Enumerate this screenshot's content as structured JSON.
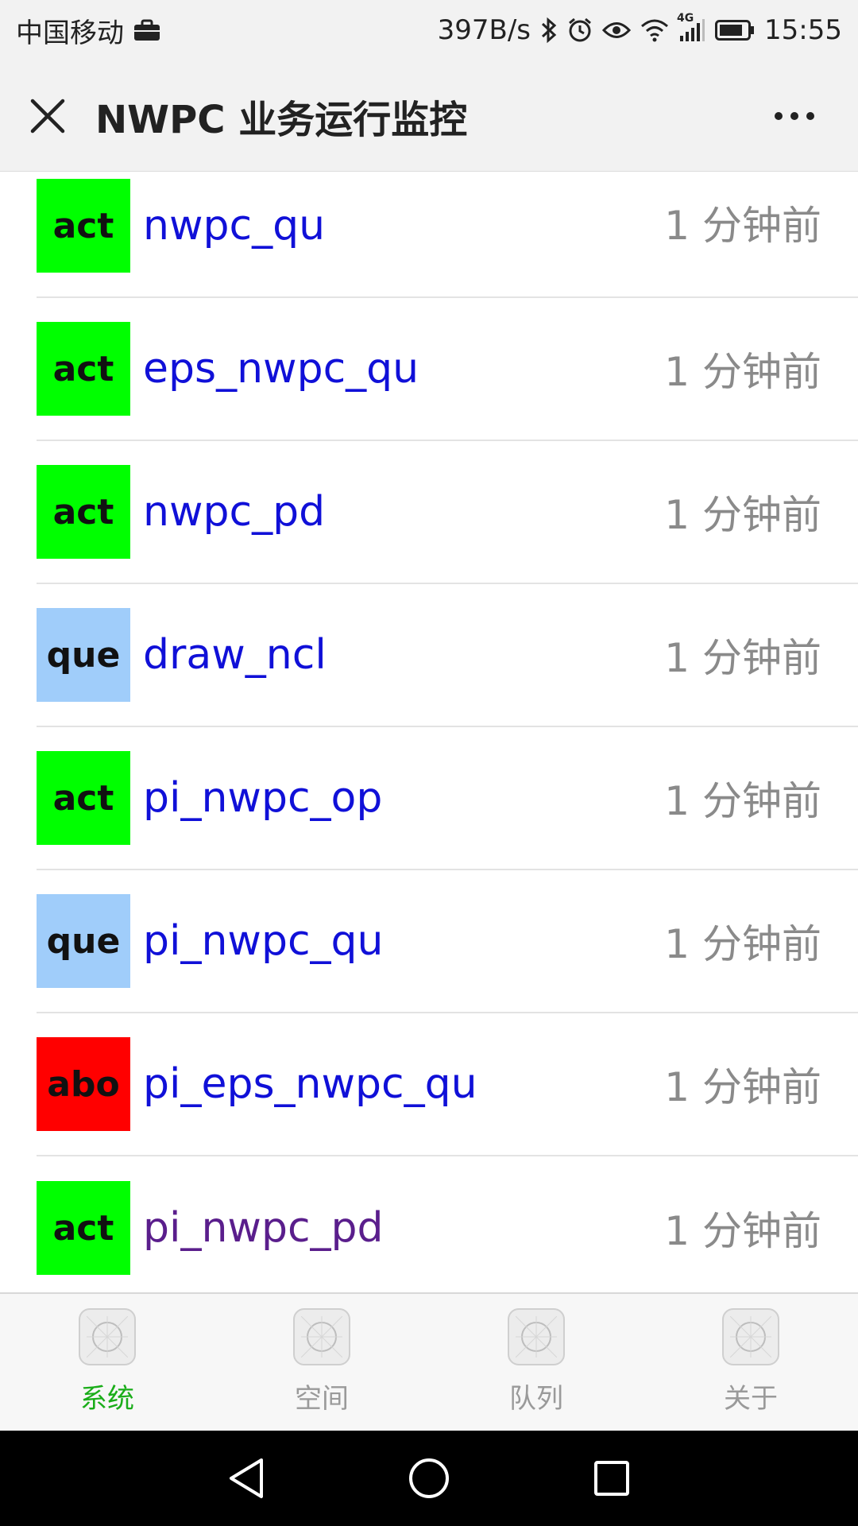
{
  "status_bar": {
    "carrier": "中国移动",
    "net_speed": "397B/s",
    "network": "4G",
    "time": "15:55"
  },
  "header": {
    "title": "NWPC 业务运行监控"
  },
  "list": {
    "items": [
      {
        "status": "act",
        "status_color": "#00ff00",
        "name": "nwpc_qu",
        "name_color": "#1010d8",
        "time": "1 分钟前"
      },
      {
        "status": "act",
        "status_color": "#00ff00",
        "name": "eps_nwpc_qu",
        "name_color": "#1010d8",
        "time": "1 分钟前"
      },
      {
        "status": "act",
        "status_color": "#00ff00",
        "name": "nwpc_pd",
        "name_color": "#1010d8",
        "time": "1 分钟前"
      },
      {
        "status": "que",
        "status_color": "#a0cdfa",
        "name": "draw_ncl",
        "name_color": "#1010d8",
        "time": "1 分钟前"
      },
      {
        "status": "act",
        "status_color": "#00ff00",
        "name": "pi_nwpc_op",
        "name_color": "#1010d8",
        "time": "1 分钟前"
      },
      {
        "status": "que",
        "status_color": "#a0cdfa",
        "name": "pi_nwpc_qu",
        "name_color": "#1010d8",
        "time": "1 分钟前"
      },
      {
        "status": "abo",
        "status_color": "#ff0000",
        "name": "pi_eps_nwpc_qu",
        "name_color": "#1010d8",
        "time": "1 分钟前"
      },
      {
        "status": "act",
        "status_color": "#00ff00",
        "name": "pi_nwpc_pd",
        "name_color": "#5a1e8c",
        "time": "1 分钟前"
      }
    ]
  },
  "tabbar": {
    "tabs": [
      {
        "label": "系统",
        "active": true
      },
      {
        "label": "空间",
        "active": false
      },
      {
        "label": "队列",
        "active": false
      },
      {
        "label": "关于",
        "active": false
      }
    ]
  },
  "colors": {
    "tab_active": "#1aad19",
    "tab_inactive": "#9a9a9a",
    "time_text": "#8a8a8a"
  }
}
